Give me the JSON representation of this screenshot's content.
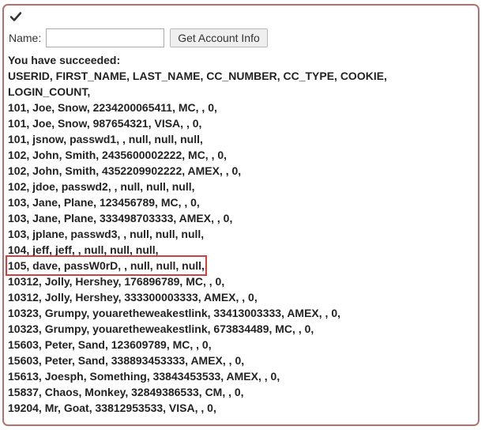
{
  "panel": {
    "check_icon": "checkmark-icon",
    "border_color": "#b4726f"
  },
  "form": {
    "name_label": "Name:",
    "name_value": "",
    "submit_label": "Get Account Info"
  },
  "result": {
    "status": "You have succeeded:",
    "header_lines": [
      "USERID, FIRST_NAME, LAST_NAME, CC_NUMBER, CC_TYPE, COOKIE,",
      "LOGIN_COUNT,"
    ],
    "rows": [
      "101, Joe, Snow, 2234200065411, MC, , 0,",
      "101, Joe, Snow, 987654321, VISA, , 0,",
      "101, jsnow, passwd1, , null, null, null,",
      "102, John, Smith, 2435600002222, MC, , 0,",
      "102, John, Smith, 4352209902222, AMEX, , 0,",
      "102, jdoe, passwd2, , null, null, null,",
      "103, Jane, Plane, 123456789, MC, , 0,",
      "103, Jane, Plane, 333498703333, AMEX, , 0,",
      "103, jplane, passwd3, , null, null, null,",
      "104, jeff, jeff, , null, null, null,",
      "105, dave, passW0rD, , null, null, null,",
      "10312, Jolly, Hershey, 176896789, MC, , 0,",
      "10312, Jolly, Hershey, 333300003333, AMEX, , 0,",
      "10323, Grumpy, youaretheweakestlink, 33413003333, AMEX, , 0,",
      "10323, Grumpy, youaretheweakestlink, 673834489, MC, , 0,",
      "15603, Peter, Sand, 123609789, MC, , 0,",
      "15603, Peter, Sand, 338893453333, AMEX, , 0,",
      "15613, Joesph, Something, 33843453533, AMEX, , 0,",
      "15837, Chaos, Monkey, 32849386533, CM, , 0,",
      "19204, Mr, Goat, 33812953533, VISA, , 0,"
    ],
    "highlight_color": "#d43f3f"
  }
}
